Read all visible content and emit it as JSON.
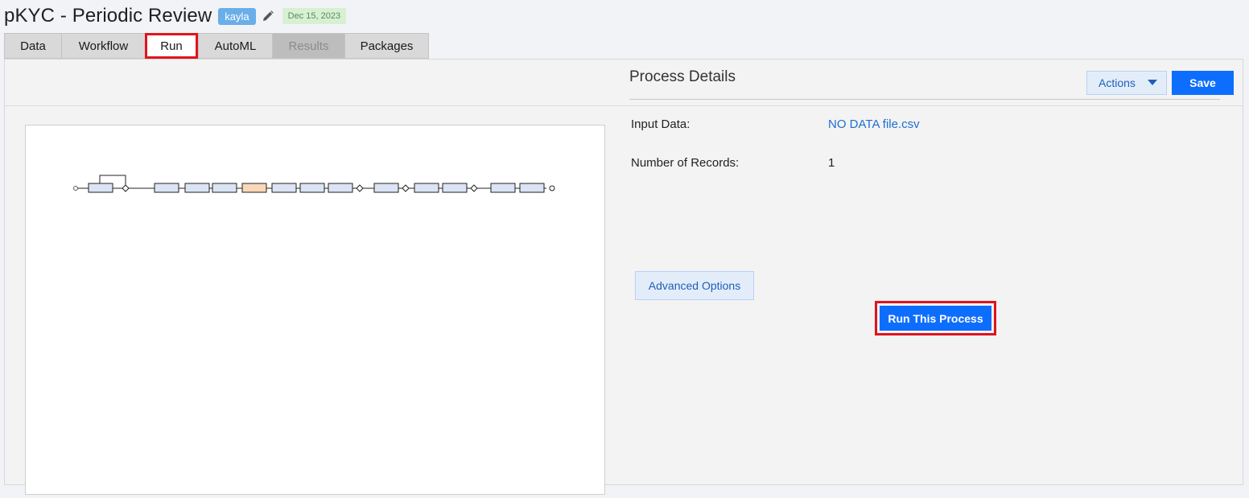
{
  "header": {
    "title": "pKYC - Periodic Review",
    "user": "kayla",
    "date": "Dec 15, 2023",
    "edit_icon": "pencil-icon"
  },
  "tabs": [
    {
      "label": "Data",
      "state": "normal"
    },
    {
      "label": "Workflow",
      "state": "normal"
    },
    {
      "label": "Run",
      "state": "active"
    },
    {
      "label": "AutoML",
      "state": "normal"
    },
    {
      "label": "Results",
      "state": "disabled"
    },
    {
      "label": "Packages",
      "state": "normal"
    }
  ],
  "toolbar": {
    "actions_label": "Actions",
    "save_label": "Save"
  },
  "details": {
    "title": "Process Details",
    "input_data_label": "Input Data:",
    "input_data_value": "NO DATA file.csv",
    "records_label": "Number of Records:",
    "records_value": "1",
    "advanced_label": "Advanced Options",
    "run_label": "Run This Process"
  },
  "colors": {
    "accent": "#0d6efd",
    "highlight": "#e0141e",
    "link": "#1e6fd0",
    "highlighted_node": "#f8d8b8"
  }
}
